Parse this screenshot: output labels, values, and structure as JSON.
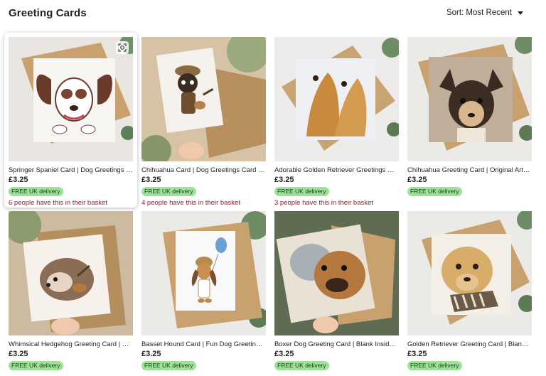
{
  "header": {
    "title": "Greeting Cards",
    "sort_label": "Sort: Most Recent"
  },
  "colors": {
    "badge_bg": "#9ee29a",
    "basket_text": "#a61a2e"
  },
  "products": [
    {
      "title": "Springer Spaniel Card | Dog Greetings Card",
      "price": "£3.25",
      "badge": "FREE UK delivery",
      "basket": "6 people have this in their basket",
      "image_subject": "springer-spaniel-painting"
    },
    {
      "title": "Chihuahua Card | Dog Greetings Card with Ukulele",
      "price": "£3.25",
      "badge": "FREE UK delivery",
      "basket": "4 people have this in their basket",
      "image_subject": "chihuahua-with-ukulele"
    },
    {
      "title": "Adorable Golden Retriever Greetings Card",
      "price": "£3.25",
      "badge": "FREE UK delivery",
      "basket": "3 people have this in their basket",
      "image_subject": "golden-retrievers"
    },
    {
      "title": "Chihuahua Greeting Card | Original Art Print",
      "price": "£3.25",
      "badge": "FREE UK delivery",
      "basket": "",
      "image_subject": "chihuahua-portrait"
    },
    {
      "title": "Whimsical Hedgehog Greeting Card | Hedgehog",
      "price": "£3.25",
      "badge": "FREE UK delivery",
      "basket": "",
      "image_subject": "hedgehog-with-guitar"
    },
    {
      "title": "Basset Hound Card | Fun Dog Greetings Card",
      "price": "£3.25",
      "badge": "FREE UK delivery",
      "basket": "",
      "image_subject": "basset-hound-with-balloon"
    },
    {
      "title": "Boxer Dog Greeting Card | Blank Inside Card",
      "price": "£3.25",
      "badge": "FREE UK delivery",
      "basket": "",
      "image_subject": "boxer-dog-portrait"
    },
    {
      "title": "Golden Retriever Greeting Card | Blank Inside",
      "price": "£3.25",
      "badge": "FREE UK delivery",
      "basket": "",
      "image_subject": "golden-retriever-with-scarf"
    }
  ]
}
